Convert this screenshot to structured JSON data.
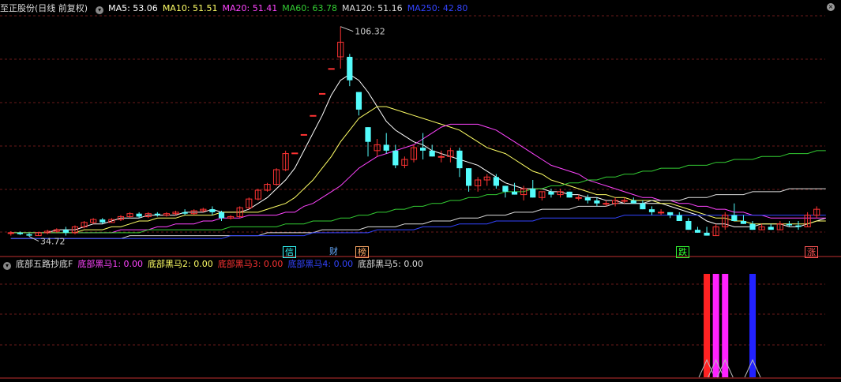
{
  "header": {
    "title": "至正股份(日线 前复权)",
    "ma": [
      {
        "label": "MA5: 53.06",
        "color": "#ffffff"
      },
      {
        "label": "MA10: 51.51",
        "color": "#ffff66"
      },
      {
        "label": "MA20: 51.41",
        "color": "#ff44ff"
      },
      {
        "label": "MA60: 63.78",
        "color": "#33cc33"
      },
      {
        "label": "MA120: 51.16",
        "color": "#dddddd"
      },
      {
        "label": "MA250: 42.80",
        "color": "#3344ff"
      }
    ]
  },
  "indicator": {
    "title": "底部五路抄底F",
    "items": [
      {
        "label": "底部黑马1: 0.00",
        "color": "#ff44ff"
      },
      {
        "label": "底部黑马2: 0.00",
        "color": "#ffff66"
      },
      {
        "label": "底部黑马3: 0.00",
        "color": "#ff3333"
      },
      {
        "label": "底部黑马4: 0.00",
        "color": "#3344ff"
      },
      {
        "label": "底部黑马5: 0.00",
        "color": "#dddddd"
      }
    ]
  },
  "annotations": {
    "high": "106.32",
    "low": "34.72"
  },
  "events": [
    {
      "label": "信",
      "color": "#33ffff"
    },
    {
      "label": "财",
      "color": "#66aaff"
    },
    {
      "label": "榜",
      "color": "#ffaa66"
    },
    {
      "label": "跌",
      "color": "#33ff33"
    },
    {
      "label": "涨",
      "color": "#ff5555"
    }
  ],
  "colors": {
    "up": "#ff3333",
    "down": "#54fcfc"
  },
  "chart_data": [
    {
      "type": "candlestick",
      "candles": [
        [
          36,
          36.5,
          35,
          36
        ],
        [
          36,
          36.4,
          35.2,
          35.5
        ],
        [
          35.5,
          36,
          34.72,
          35
        ],
        [
          35,
          36.2,
          34.9,
          36
        ],
        [
          36,
          37,
          35.5,
          36.5
        ],
        [
          36.5,
          37.5,
          36,
          37
        ],
        [
          37,
          38,
          35,
          36
        ],
        [
          36,
          38.5,
          35.5,
          38
        ],
        [
          38,
          40,
          37.5,
          39.5
        ],
        [
          39.5,
          41,
          39,
          40.5
        ],
        [
          40.5,
          41,
          39,
          39.5
        ],
        [
          39.5,
          41,
          39.5,
          40.5
        ],
        [
          40.5,
          42,
          40,
          41.5
        ],
        [
          41.5,
          43,
          41,
          42.5
        ],
        [
          42.5,
          43,
          41,
          41.5
        ],
        [
          41.5,
          43,
          41,
          42.5
        ],
        [
          42.5,
          43,
          41.5,
          42
        ],
        [
          42,
          43,
          41.5,
          42.5
        ],
        [
          42.5,
          43.5,
          42,
          43
        ],
        [
          43,
          44,
          42,
          42.5
        ],
        [
          42.5,
          44,
          42,
          43.5
        ],
        [
          43.5,
          44.5,
          43,
          44
        ],
        [
          44,
          45,
          42,
          43
        ],
        [
          43,
          43.5,
          40,
          41
        ],
        [
          41,
          42,
          40.5,
          41.5
        ],
        [
          41.5,
          45,
          41,
          44.5
        ],
        [
          44.5,
          48,
          44,
          47.5
        ],
        [
          47.5,
          51,
          47,
          50.5
        ],
        [
          50.5,
          53,
          50,
          52.5
        ],
        [
          52.5,
          58,
          52,
          57.5
        ],
        [
          57.5,
          64,
          57,
          63
        ],
        [
          63.2,
          63.2,
          63.2,
          63.2
        ],
        [
          69.5,
          69.5,
          69.5,
          69.5
        ],
        [
          76,
          76,
          76,
          76
        ],
        [
          83.5,
          83.5,
          83.5,
          83.5
        ],
        [
          92,
          92,
          92,
          92
        ],
        [
          96,
          106.32,
          92,
          101
        ],
        [
          96,
          97,
          86,
          88
        ],
        [
          84,
          84,
          76,
          78
        ],
        [
          72,
          72,
          62,
          67
        ],
        [
          64,
          68,
          62,
          66
        ],
        [
          66,
          70,
          63,
          64
        ],
        [
          64,
          66,
          58,
          59
        ],
        [
          59,
          62,
          58,
          61
        ],
        [
          61,
          66,
          60,
          65
        ],
        [
          65,
          70,
          61,
          64
        ],
        [
          64,
          66,
          62,
          62
        ],
        [
          62,
          64,
          60,
          62
        ],
        [
          62,
          65,
          60,
          64
        ],
        [
          64,
          65,
          55,
          58
        ],
        [
          58,
          58,
          50,
          52
        ],
        [
          52,
          55,
          50,
          54
        ],
        [
          54,
          56,
          52,
          55
        ],
        [
          55,
          56,
          51,
          52
        ],
        [
          52,
          52,
          48,
          50
        ],
        [
          50,
          53,
          49,
          49
        ],
        [
          49,
          52,
          47,
          51
        ],
        [
          51,
          54,
          48,
          48
        ],
        [
          48,
          50,
          47,
          50
        ],
        [
          50,
          51,
          48,
          49
        ],
        [
          49,
          51,
          48,
          50
        ],
        [
          50,
          50,
          48,
          48
        ],
        [
          48,
          49,
          47,
          48
        ],
        [
          48,
          49,
          46,
          47
        ],
        [
          47,
          48,
          45,
          46
        ],
        [
          46,
          47,
          45,
          46
        ],
        [
          46,
          48,
          45,
          47
        ],
        [
          47,
          48,
          46,
          47
        ],
        [
          47,
          48,
          46,
          46
        ],
        [
          46,
          47,
          44,
          44
        ],
        [
          44,
          45,
          42,
          43
        ],
        [
          43,
          44,
          42,
          43
        ],
        [
          43,
          43,
          41,
          42
        ],
        [
          42,
          43,
          40,
          40
        ],
        [
          40,
          41,
          37,
          37
        ],
        [
          37,
          38,
          36,
          36
        ],
        [
          36,
          38,
          35,
          35
        ],
        [
          35,
          39,
          35,
          38
        ],
        [
          38,
          43,
          37,
          42
        ],
        [
          42,
          46,
          41,
          40
        ],
        [
          40,
          42,
          39,
          39
        ],
        [
          39,
          40,
          37,
          37
        ],
        [
          37,
          39,
          37,
          38
        ],
        [
          38,
          39,
          37,
          37
        ],
        [
          37,
          40,
          37,
          39
        ],
        [
          39,
          40,
          38,
          38.5
        ],
        [
          38.5,
          40,
          37,
          38
        ],
        [
          38,
          43,
          38,
          42
        ],
        [
          42,
          45,
          41,
          44
        ]
      ],
      "series": [
        {
          "name": "MA5",
          "values": [
            36,
            36,
            36,
            36,
            36,
            37,
            37,
            37,
            38,
            39,
            39,
            40,
            41,
            41,
            41,
            42,
            42,
            42,
            42,
            43,
            43,
            43,
            44,
            43,
            43,
            43,
            44,
            46,
            48,
            51,
            54,
            58,
            64,
            70,
            76,
            83,
            88,
            90,
            88,
            84,
            79,
            74,
            71,
            69,
            67,
            66,
            64,
            63,
            62,
            61,
            60,
            59,
            57,
            55,
            53,
            52,
            51,
            51,
            51,
            50,
            50,
            49,
            49,
            48,
            48,
            47,
            47,
            46,
            46,
            46,
            46,
            46,
            45,
            44,
            43,
            42,
            40,
            39,
            39,
            38,
            38,
            38,
            39,
            39,
            39,
            38,
            38,
            39,
            40,
            41
          ]
        },
        {
          "name": "MA10",
          "values": [
            36,
            36,
            36,
            36,
            36,
            36,
            36,
            36,
            37,
            37,
            37,
            38,
            38,
            39,
            40,
            40,
            41,
            41,
            41,
            42,
            42,
            42,
            42,
            43,
            43,
            43,
            43,
            43,
            44,
            45,
            46,
            48,
            51,
            54,
            58,
            62,
            67,
            71,
            75,
            77,
            79,
            79,
            78,
            77,
            76,
            75,
            74,
            73,
            72,
            71,
            69,
            67,
            65,
            64,
            63,
            61,
            59,
            57,
            56,
            54,
            53,
            52,
            51,
            50,
            49,
            49,
            48,
            48,
            47,
            47,
            47,
            46,
            46,
            45,
            44,
            43,
            42,
            41,
            41,
            40,
            40,
            39,
            39,
            39,
            39,
            39,
            39,
            39,
            40,
            40
          ]
        },
        {
          "name": "MA20",
          "values": [
            36,
            36,
            36,
            36,
            36,
            36,
            36,
            36,
            36,
            36,
            36,
            36,
            37,
            37,
            37,
            37,
            38,
            38,
            39,
            39,
            39,
            40,
            40,
            41,
            41,
            41,
            42,
            42,
            42,
            42,
            43,
            43,
            45,
            46,
            48,
            50,
            52,
            55,
            58,
            60,
            62,
            63,
            64,
            65,
            66,
            68,
            70,
            72,
            73,
            73,
            73,
            73,
            72,
            71,
            69,
            67,
            65,
            63,
            61,
            59,
            58,
            57,
            56,
            54,
            53,
            52,
            51,
            50,
            49,
            48,
            48,
            47,
            47,
            46,
            46,
            45,
            45,
            44,
            44,
            43,
            43,
            42,
            42,
            41,
            41,
            41,
            41,
            41,
            41,
            41
          ]
        },
        {
          "name": "MA60",
          "values": [
            36,
            36,
            36,
            36,
            36,
            36,
            36,
            36,
            36,
            36,
            36,
            36,
            36,
            36,
            36,
            37,
            37,
            37,
            37,
            37,
            37,
            37,
            37,
            37,
            38,
            38,
            38,
            38,
            38,
            38,
            39,
            39,
            39,
            40,
            40,
            40,
            41,
            41,
            42,
            42,
            43,
            43,
            44,
            44,
            45,
            45,
            46,
            46,
            47,
            47,
            48,
            48,
            49,
            49,
            50,
            50,
            50,
            51,
            51,
            52,
            52,
            53,
            53,
            54,
            54,
            55,
            55,
            56,
            56,
            57,
            57,
            58,
            58,
            58,
            59,
            59,
            59,
            60,
            60,
            61,
            61,
            61,
            62,
            62,
            62,
            63,
            63,
            63,
            64,
            64
          ]
        },
        {
          "name": "MA120",
          "values": [
            34,
            34,
            34,
            34,
            34,
            34,
            34,
            34,
            34,
            34,
            34,
            34,
            34,
            35,
            35,
            35,
            35,
            35,
            35,
            35,
            35,
            35,
            35,
            35,
            35,
            35,
            35,
            35,
            36,
            36,
            36,
            36,
            36,
            36,
            37,
            37,
            37,
            37,
            37,
            38,
            38,
            38,
            38,
            39,
            39,
            39,
            40,
            40,
            40,
            41,
            41,
            41,
            42,
            42,
            42,
            43,
            43,
            43,
            44,
            44,
            44,
            44,
            45,
            45,
            45,
            45,
            46,
            46,
            46,
            46,
            47,
            47,
            47,
            47,
            48,
            48,
            48,
            49,
            49,
            49,
            49,
            50,
            50,
            50,
            50,
            51,
            51,
            51,
            51,
            51
          ]
        },
        {
          "name": "MA250",
          "values": [
            34,
            34,
            34,
            34,
            34,
            34,
            34,
            34,
            34,
            34,
            34,
            34,
            34,
            34,
            34,
            34,
            34,
            34,
            34,
            34,
            34,
            34,
            34,
            34,
            35,
            35,
            35,
            35,
            35,
            35,
            35,
            35,
            35,
            36,
            36,
            36,
            36,
            36,
            36,
            36,
            37,
            37,
            37,
            37,
            37,
            38,
            38,
            38,
            38,
            39,
            39,
            39,
            39,
            40,
            40,
            40,
            40,
            40,
            41,
            41,
            41,
            41,
            41,
            41,
            41,
            41,
            41,
            42,
            42,
            42,
            42,
            42,
            42,
            42,
            42,
            42,
            42,
            42,
            42,
            42,
            42,
            42,
            42,
            42,
            42,
            42,
            42,
            42,
            42,
            42
          ]
        }
      ],
      "ylim": [
        33,
        110
      ]
    },
    {
      "type": "bar",
      "title": "底部五路抄底F",
      "series": [
        {
          "name": "底部黑马1",
          "values": [
            0,
            0
          ]
        },
        {
          "name": "底部黑马2",
          "values": [
            0,
            0
          ]
        },
        {
          "name": "底部黑马3",
          "values": [
            0,
            0
          ]
        },
        {
          "name": "底部黑马4",
          "values": [
            0,
            0
          ]
        },
        {
          "name": "底部黑马5",
          "values": [
            0,
            0
          ]
        }
      ],
      "signals": [
        {
          "index": 76,
          "color": "#ff2222",
          "value": 1
        },
        {
          "index": 77,
          "color": "#ff22ff",
          "value": 1
        },
        {
          "index": 78,
          "color": "#ff22ff",
          "value": 1
        },
        {
          "index": 81,
          "color": "#2222ff",
          "value": 1
        }
      ]
    }
  ]
}
